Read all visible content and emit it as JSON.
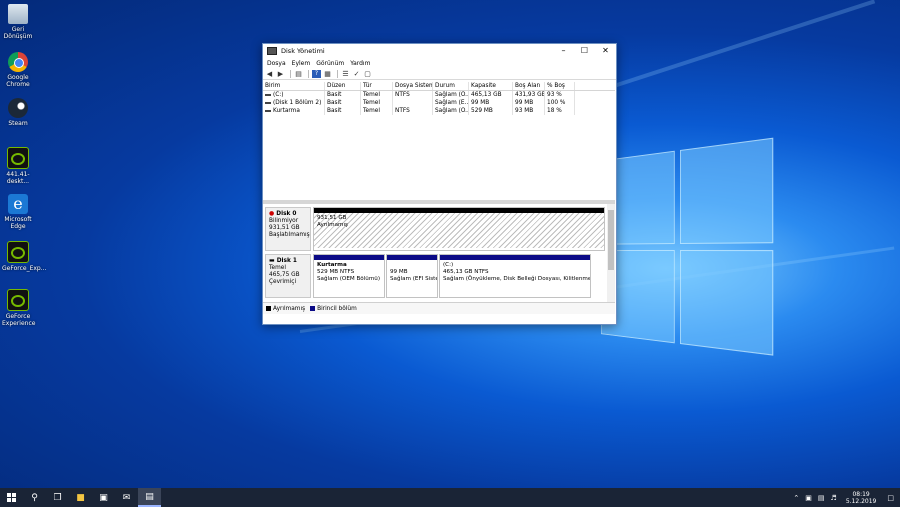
{
  "desktop": {
    "icons": [
      {
        "label": "Geri Dönüşüm",
        "icon": "recycle-bin-icon"
      },
      {
        "label": "Google Chrome",
        "icon": "chrome-icon"
      },
      {
        "label": "Steam",
        "icon": "steam-icon"
      },
      {
        "label": "441.41-deskt...",
        "icon": "nvidia-icon"
      },
      {
        "label": "Microsoft Edge",
        "icon": "edge-icon"
      },
      {
        "label": "GeForce_Exp...",
        "icon": "nvidia-icon"
      },
      {
        "label": "GeForce Experience",
        "icon": "nvidia-icon"
      }
    ]
  },
  "window": {
    "title": "Disk Yönetimi",
    "menu": [
      "Dosya",
      "Eylem",
      "Görünüm",
      "Yardım"
    ],
    "columns": [
      "Birim",
      "Düzen",
      "Tür",
      "Dosya Sistemi",
      "Durum",
      "Kapasite",
      "Boş Alan",
      "% Boş"
    ],
    "volumes": [
      [
        "(C:)",
        "Basit",
        "Temel",
        "NTFS",
        "Sağlam (Ö...",
        "465,13 GB",
        "431,93 GB",
        "93 %"
      ],
      [
        "(Disk 1 Bölüm 2)",
        "Basit",
        "Temel",
        "",
        "Sağlam (E...",
        "99 MB",
        "99 MB",
        "100 %"
      ],
      [
        "Kurtarma",
        "Basit",
        "Temel",
        "NTFS",
        "Sağlam (O...",
        "529 MB",
        "93 MB",
        "18 %"
      ]
    ],
    "disks": [
      {
        "name": "Disk 0",
        "type": "Bilinmiyor",
        "size": "931,51 GB",
        "status": "Başlatılmamış",
        "partitions": [
          {
            "kind": "unalloc",
            "name": "",
            "line1": "931,51 GB",
            "line2": "Ayrılmamış"
          }
        ]
      },
      {
        "name": "Disk 1",
        "type": "Temel",
        "size": "465,75 GB",
        "status": "Çevrimiçi",
        "partitions": [
          {
            "kind": "primary",
            "name": "Kurtarma",
            "line1": "529 MB NTFS",
            "line2": "Sağlam (OEM Bölümü)"
          },
          {
            "kind": "primary",
            "name": "",
            "line1": "99 MB",
            "line2": "Sağlam (EFI Sistem"
          },
          {
            "kind": "primary",
            "name": "(C:)",
            "line1": "465,13 GB NTFS",
            "line2": "Sağlam (Önyükleme, Disk Belleği Dosyası, Kilitlenme Bilgisi"
          }
        ]
      }
    ],
    "legend": [
      "Ayrılmamış",
      "Birincil bölüm"
    ],
    "colors": {
      "unallocated": "#000000",
      "primary": "#0b0a86"
    }
  },
  "taskbar": {
    "time": "08:19",
    "date": "5.12.2019"
  }
}
